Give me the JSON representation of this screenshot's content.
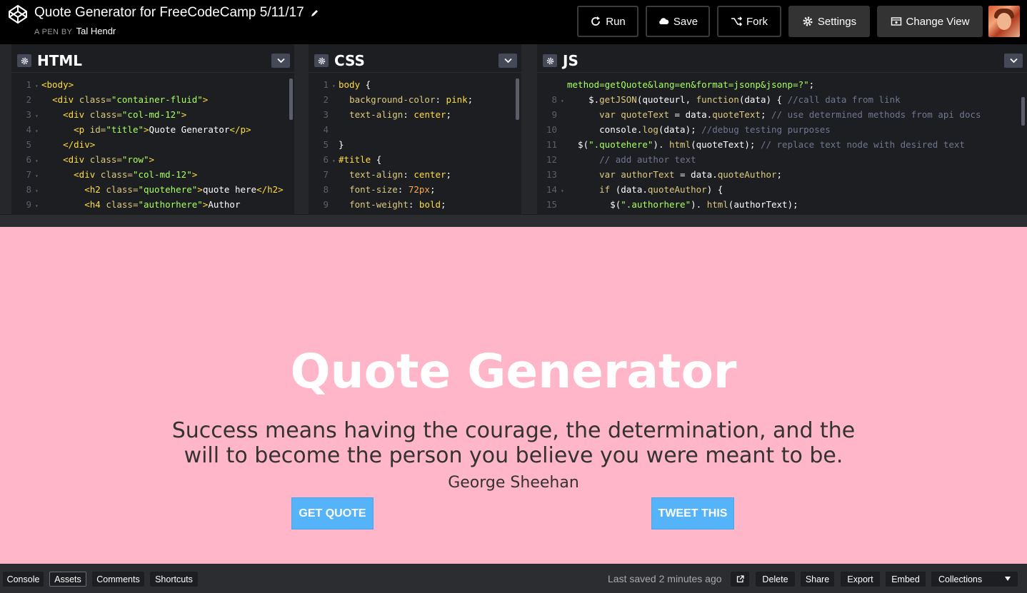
{
  "header": {
    "title": "Quote Generator for FreeCodeCamp 5/11/17",
    "by_label": "A PEN BY",
    "author": "Tal Hendr",
    "buttons": {
      "run": "Run",
      "save": "Save",
      "fork": "Fork",
      "settings": "Settings",
      "change_view": "Change View"
    }
  },
  "editors": {
    "html": {
      "title": "HTML",
      "lines": [
        {
          "n": "1",
          "fold": true,
          "parts": [
            [
              "t-tag",
              "<body>"
            ]
          ]
        },
        {
          "n": "2",
          "fold": false,
          "parts": [
            [
              "",
              "  "
            ],
            [
              "t-tag",
              "<div "
            ],
            [
              "t-attr",
              "class="
            ],
            [
              "t-str",
              "\"container-fluid\""
            ],
            [
              "t-tag",
              ">"
            ]
          ]
        },
        {
          "n": "3",
          "fold": true,
          "parts": [
            [
              "",
              "    "
            ],
            [
              "t-tag",
              "<div "
            ],
            [
              "t-attr",
              "class="
            ],
            [
              "t-str",
              "\"col-md-12\""
            ],
            [
              "t-tag",
              ">"
            ]
          ]
        },
        {
          "n": "4",
          "fold": true,
          "parts": [
            [
              "",
              "      "
            ],
            [
              "t-tag",
              "<p "
            ],
            [
              "t-attr",
              "id="
            ],
            [
              "t-str",
              "\"title\""
            ],
            [
              "t-tag",
              ">"
            ],
            [
              "",
              "Quote Generator"
            ],
            [
              "t-tag",
              "</p>"
            ]
          ]
        },
        {
          "n": "5",
          "fold": false,
          "parts": [
            [
              "",
              "    "
            ],
            [
              "t-tag",
              "</div>"
            ]
          ]
        },
        {
          "n": "6",
          "fold": true,
          "parts": [
            [
              "",
              "    "
            ],
            [
              "t-tag",
              "<div "
            ],
            [
              "t-attr",
              "class="
            ],
            [
              "t-str",
              "\"row\""
            ],
            [
              "t-tag",
              ">"
            ]
          ]
        },
        {
          "n": "7",
          "fold": true,
          "parts": [
            [
              "",
              "      "
            ],
            [
              "t-tag",
              "<div "
            ],
            [
              "t-attr",
              "class="
            ],
            [
              "t-str",
              "\"col-md-12\""
            ],
            [
              "t-tag",
              ">"
            ]
          ]
        },
        {
          "n": "8",
          "fold": true,
          "parts": [
            [
              "",
              "        "
            ],
            [
              "t-tag",
              "<h2 "
            ],
            [
              "t-attr",
              "class="
            ],
            [
              "t-str",
              "\"quotehere\""
            ],
            [
              "t-tag",
              ">"
            ],
            [
              "",
              "quote here"
            ],
            [
              "t-tag",
              "</h2>"
            ]
          ]
        },
        {
          "n": "9",
          "fold": true,
          "parts": [
            [
              "",
              "        "
            ],
            [
              "t-tag",
              "<h4 "
            ],
            [
              "t-attr",
              "class="
            ],
            [
              "t-str",
              "\"authorhere\""
            ],
            [
              "t-tag",
              ">"
            ],
            [
              "",
              "Author"
            ]
          ]
        }
      ]
    },
    "css": {
      "title": "CSS",
      "lines": [
        {
          "n": "1",
          "fold": true,
          "parts": [
            [
              "t-sel",
              "body "
            ],
            [
              "t-fn",
              "{"
            ]
          ]
        },
        {
          "n": "2",
          "fold": false,
          "parts": [
            [
              "",
              "  "
            ],
            [
              "t-prop",
              "background-color"
            ],
            [
              "",
              ": "
            ],
            [
              "t-val",
              "pink"
            ],
            [
              "",
              ";"
            ]
          ]
        },
        {
          "n": "3",
          "fold": false,
          "parts": [
            [
              "",
              "  "
            ],
            [
              "t-prop",
              "text-align"
            ],
            [
              "",
              ": "
            ],
            [
              "t-val",
              "center"
            ],
            [
              "",
              ";"
            ]
          ]
        },
        {
          "n": "4",
          "fold": false,
          "parts": [
            [
              "",
              ""
            ]
          ]
        },
        {
          "n": "5",
          "fold": false,
          "parts": [
            [
              "",
              "}"
            ]
          ]
        },
        {
          "n": "6",
          "fold": true,
          "parts": [
            [
              "t-sel",
              "#title "
            ],
            [
              "t-fn",
              "{"
            ]
          ]
        },
        {
          "n": "7",
          "fold": false,
          "parts": [
            [
              "",
              "  "
            ],
            [
              "t-prop",
              "text-align"
            ],
            [
              "",
              ": "
            ],
            [
              "t-val",
              "center"
            ],
            [
              "",
              ";"
            ]
          ]
        },
        {
          "n": "8",
          "fold": false,
          "parts": [
            [
              "",
              "  "
            ],
            [
              "t-prop",
              "font-size"
            ],
            [
              "",
              ": "
            ],
            [
              "t-num",
              "72px"
            ],
            [
              "",
              ";"
            ]
          ]
        },
        {
          "n": "9",
          "fold": false,
          "parts": [
            [
              "",
              "  "
            ],
            [
              "t-prop",
              "font-weight"
            ],
            [
              "",
              ": "
            ],
            [
              "t-val",
              "bold"
            ],
            [
              "",
              ";"
            ]
          ]
        }
      ]
    },
    "js": {
      "title": "JS",
      "lines": [
        {
          "n": "",
          "fold": false,
          "parts": [
            [
              "t-str",
              "method=getQuote&lang=en&format=jsonp&jsonp=?\""
            ],
            [
              "",
              ";"
            ]
          ]
        },
        {
          "n": "8",
          "fold": true,
          "parts": [
            [
              "",
              "    $."
            ],
            [
              "t-var",
              "getJSON"
            ],
            [
              "",
              "(quoteurl, "
            ],
            [
              "t-kw",
              "function"
            ],
            [
              "",
              "(data) { "
            ],
            [
              "t-com",
              "//call data from link"
            ]
          ]
        },
        {
          "n": "9",
          "fold": false,
          "parts": [
            [
              "",
              "      "
            ],
            [
              "t-kw",
              "var "
            ],
            [
              "t-var",
              "quoteText"
            ],
            [
              "",
              " = data."
            ],
            [
              "t-var",
              "quoteText"
            ],
            [
              "",
              "; "
            ],
            [
              "t-com",
              "// use determined methods from api docs"
            ]
          ]
        },
        {
          "n": "10",
          "fold": false,
          "parts": [
            [
              "",
              "      console."
            ],
            [
              "t-var",
              "log"
            ],
            [
              "",
              "(data); "
            ],
            [
              "t-com",
              "//debug testing purposes"
            ]
          ]
        },
        {
          "n": "11",
          "fold": false,
          "parts": [
            [
              "",
              "  $("
            ],
            [
              "t-str",
              "\".quotehere\""
            ],
            [
              "",
              "). "
            ],
            [
              "t-var",
              "html"
            ],
            [
              "",
              "(quoteText); "
            ],
            [
              "t-com",
              "// replace text node with desired text"
            ]
          ]
        },
        {
          "n": "12",
          "fold": false,
          "parts": [
            [
              "",
              "      "
            ],
            [
              "t-com",
              "// add author text"
            ]
          ]
        },
        {
          "n": "13",
          "fold": false,
          "parts": [
            [
              "",
              "      "
            ],
            [
              "t-kw",
              "var "
            ],
            [
              "t-var",
              "authorText"
            ],
            [
              "",
              " = data."
            ],
            [
              "t-var",
              "quoteAuthor"
            ],
            [
              "",
              ";"
            ]
          ]
        },
        {
          "n": "14",
          "fold": true,
          "parts": [
            [
              "",
              "      "
            ],
            [
              "t-kw",
              "if "
            ],
            [
              "",
              "(data."
            ],
            [
              "t-var",
              "quoteAuthor"
            ],
            [
              "",
              ") {"
            ]
          ]
        },
        {
          "n": "15",
          "fold": false,
          "parts": [
            [
              "",
              "        $("
            ],
            [
              "t-str",
              "\".authorhere\""
            ],
            [
              "",
              "). "
            ],
            [
              "t-var",
              "html"
            ],
            [
              "",
              "(authorText);"
            ]
          ]
        }
      ]
    }
  },
  "preview": {
    "title": "Quote Generator",
    "quote": "Success means having the courage, the determination, and the will to become the person you believe you were meant to be.",
    "author": "George Sheehan",
    "get_quote": "GET QUOTE",
    "tweet": "TWEET THIS",
    "background": "#ffb6c8",
    "button_color": "#55b4f9"
  },
  "footer": {
    "console": "Console",
    "assets": "Assets",
    "comments": "Comments",
    "shortcuts": "Shortcuts",
    "last_saved": "Last saved 2 minutes ago",
    "delete": "Delete",
    "share": "Share",
    "export": "Export",
    "embed": "Embed",
    "collections": "Collections"
  }
}
